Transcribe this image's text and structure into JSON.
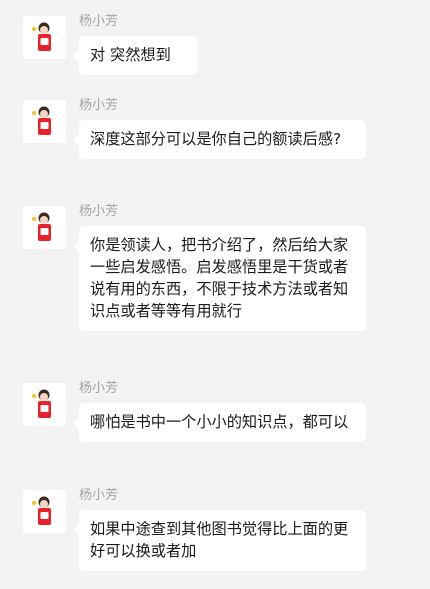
{
  "messages": [
    {
      "sender": "杨小芳",
      "avatar_icon": "cartoon-girl-avatar-icon",
      "text": "对 突然想到"
    },
    {
      "sender": "杨小芳",
      "avatar_icon": "cartoon-girl-avatar-icon",
      "text": "深度这部分可以是你自己的额读后感?"
    },
    {
      "sender": "杨小芳",
      "avatar_icon": "cartoon-girl-avatar-icon",
      "text": "你是领读人，把书介绍了，然后给大家一些启发感悟。启发感悟里是干货或者说有用的东西，不限于技术方法或者知识点或者等等有用就行"
    },
    {
      "sender": "杨小芳",
      "avatar_icon": "cartoon-girl-avatar-icon",
      "text": "哪怕是书中一个小小的知识点，都可以"
    },
    {
      "sender": "杨小芳",
      "avatar_icon": "cartoon-girl-avatar-icon",
      "text": "如果中途查到其他图书觉得比上面的更好可以换或者加"
    }
  ],
  "colors": {
    "background": "#f3f3f3",
    "bubble": "#ffffff",
    "sender_name": "#a3a3a3",
    "avatar_red": "#e8222b"
  }
}
